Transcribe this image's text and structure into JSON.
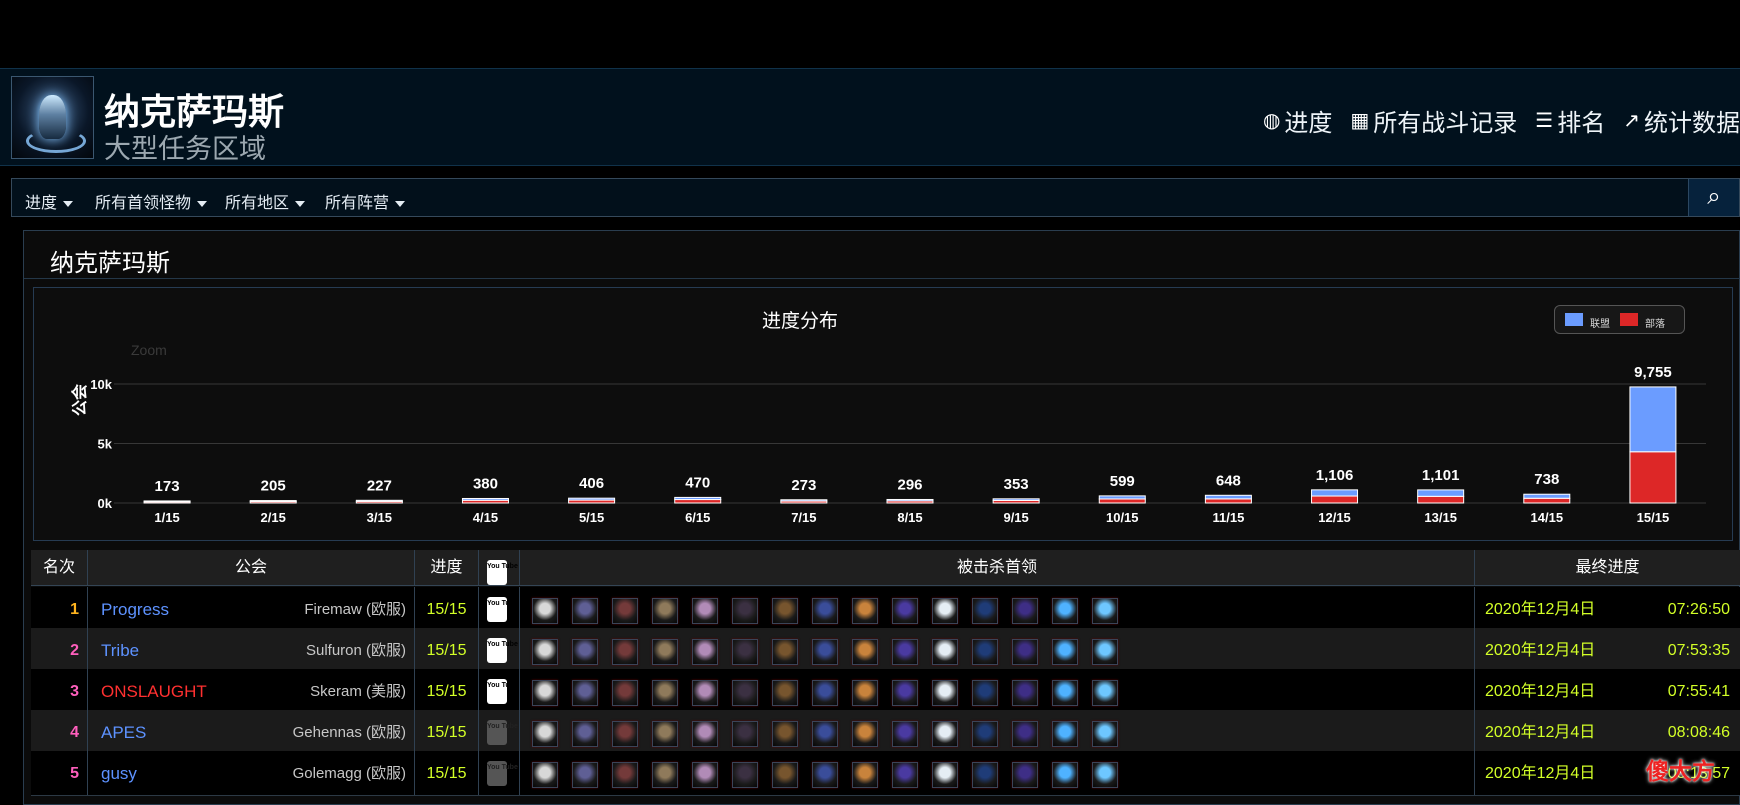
{
  "header": {
    "title": "纳克萨玛斯",
    "subtitle": "大型任务区域",
    "nav": [
      {
        "icon": "globe-icon",
        "label": "进度"
      },
      {
        "icon": "list-icon",
        "label": "所有战斗记录"
      },
      {
        "icon": "ranking-icon",
        "label": "排名"
      },
      {
        "icon": "trend-icon",
        "label": "统计数据"
      }
    ]
  },
  "menubar": {
    "items": [
      "进度",
      "所有首领怪物",
      "所有地区",
      "所有阵营"
    ],
    "search_icon": "search-icon"
  },
  "panel": {
    "title": "纳克萨玛斯"
  },
  "chart_data": {
    "type": "bar",
    "title": "进度分布",
    "ylabel": "公会",
    "zoom_label": "Zoom",
    "categories": [
      "1/15",
      "2/15",
      "3/15",
      "4/15",
      "5/15",
      "6/15",
      "7/15",
      "8/15",
      "9/15",
      "10/15",
      "11/15",
      "12/15",
      "13/15",
      "14/15",
      "15/15"
    ],
    "totals": [
      173,
      205,
      227,
      380,
      406,
      470,
      273,
      296,
      353,
      599,
      648,
      1106,
      1101,
      738,
      9755
    ],
    "total_labels": [
      "173",
      "205",
      "227",
      "380",
      "406",
      "470",
      "273",
      "296",
      "353",
      "599",
      "648",
      "1,106",
      "1,101",
      "738",
      "9,755"
    ],
    "series": [
      {
        "name": "联盟",
        "color": "#6b9cff",
        "values": [
          70,
          85,
          90,
          150,
          160,
          180,
          110,
          115,
          140,
          260,
          300,
          520,
          540,
          340,
          5450
        ]
      },
      {
        "name": "部落",
        "color": "#dd2727",
        "values": [
          103,
          120,
          137,
          230,
          246,
          290,
          163,
          181,
          213,
          339,
          348,
          586,
          561,
          398,
          4305
        ]
      }
    ],
    "ylim": [
      0,
      10000
    ],
    "y_ticks": [
      "0k",
      "5k",
      "10k"
    ],
    "legend": "top-right",
    "grid": true
  },
  "table": {
    "headers": {
      "rank": "名次",
      "guild": "公会",
      "progress": "进度",
      "video": "YouTube",
      "bosses": "被击杀首领",
      "final": "最终进度"
    },
    "rows": [
      {
        "rank": "1",
        "guild": "Progress",
        "server": "Firemaw (欧服)",
        "progress": "15/15",
        "video": "active",
        "date": "2020年12月4日",
        "time": "07:26:50"
      },
      {
        "rank": "2",
        "guild": "Tribe",
        "server": "Sulfuron (欧服)",
        "progress": "15/15",
        "video": "active",
        "date": "2020年12月4日",
        "time": "07:53:35"
      },
      {
        "rank": "3",
        "guild": "ONSLAUGHT",
        "server": "Skeram (美服)",
        "progress": "15/15",
        "video": "active",
        "date": "2020年12月4日",
        "time": "07:55:41"
      },
      {
        "rank": "4",
        "guild": "APES",
        "server": "Gehennas (欧服)",
        "progress": "15/15",
        "video": "inactive",
        "date": "2020年12月4日",
        "time": "08:08:46"
      },
      {
        "rank": "5",
        "guild": "gusy",
        "server": "Golemagg (欧服)",
        "progress": "15/15",
        "video": "inactive",
        "date": "2020年12月4日",
        "time": "08:13:57"
      }
    ],
    "youtube_text": "You Tube",
    "boss_icon_colors": [
      "#d8d8d8",
      "#5f5f95",
      "#743a3a",
      "#8f7a5b",
      "#b18bb7",
      "#3b3042",
      "#77552e",
      "#3a4d9a",
      "#c9833c",
      "#4a3aa1",
      "#e5edf4",
      "#1f3c78",
      "#3e2e86",
      "#4fb2ff",
      "#6ec7ff"
    ]
  },
  "watermark": "傻大方"
}
